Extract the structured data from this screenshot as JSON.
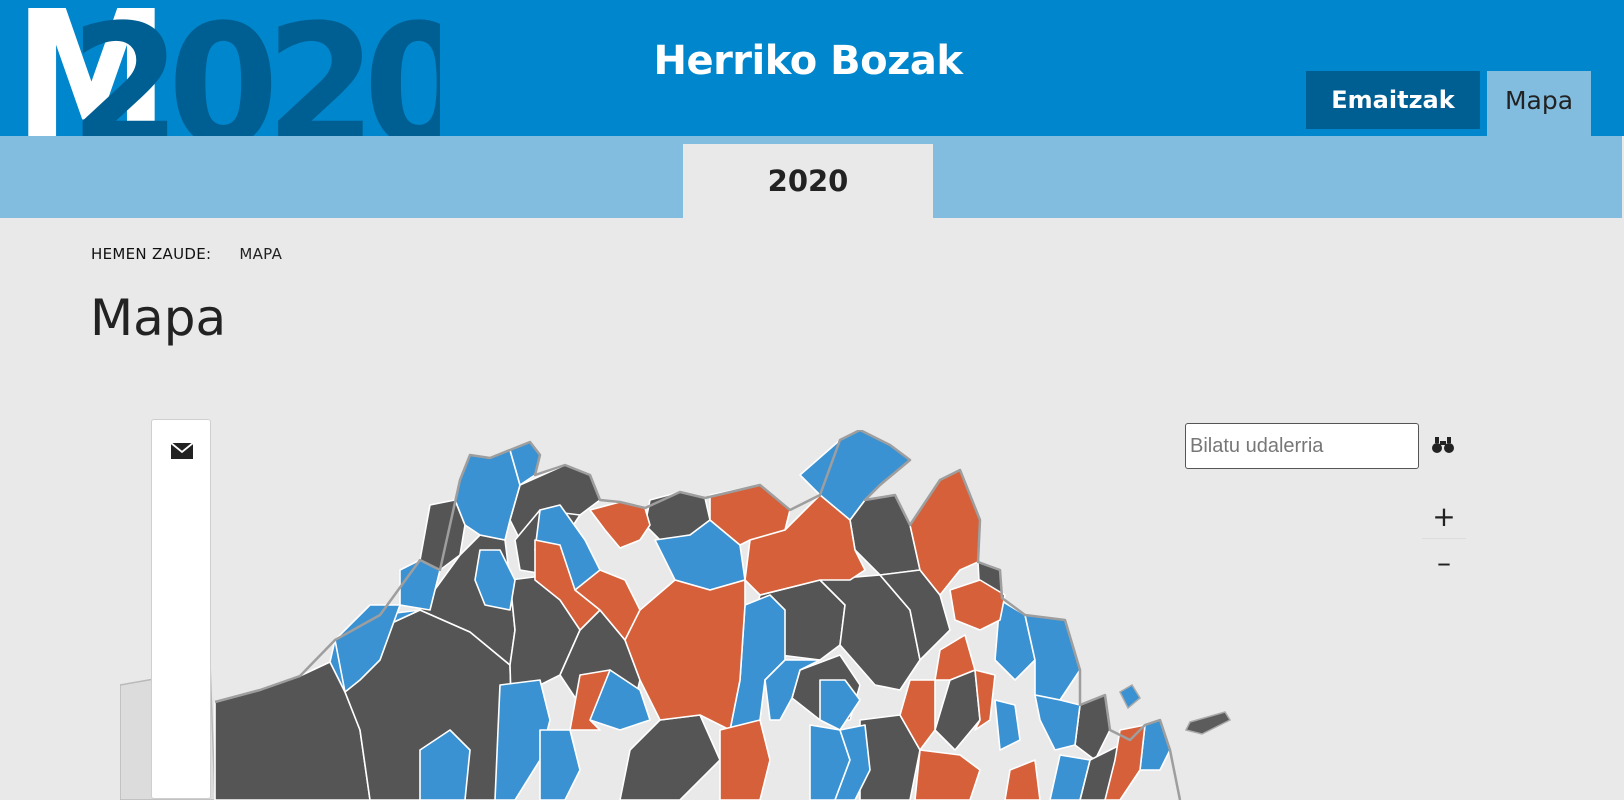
{
  "header": {
    "logo_text_m": "M",
    "logo_text_year": "2020",
    "site_title": "Herriko Bozak",
    "nav": {
      "results_label": "Emaitzak",
      "map_label": "Mapa"
    }
  },
  "subnav": {
    "year_tab": "2020"
  },
  "breadcrumb": {
    "label": "HEMEN ZAUDE:",
    "current": "MAPA"
  },
  "page_title": "Mapa",
  "search": {
    "placeholder": "Bilatu udalerria",
    "value": ""
  },
  "zoom": {
    "in_label": "+",
    "out_label": "–"
  },
  "icons": {
    "share": "envelope-icon",
    "search": "binoculars-icon",
    "zoom_in": "plus-icon",
    "zoom_out": "minus-icon"
  },
  "colors": {
    "header_blue": "#0086cc",
    "dark_blue": "#005f92",
    "light_blue": "#82bde0",
    "party_blue": "#3a92d3",
    "party_orange": "#d6603a",
    "party_dark": "#555555",
    "background": "#e9e9e9"
  }
}
